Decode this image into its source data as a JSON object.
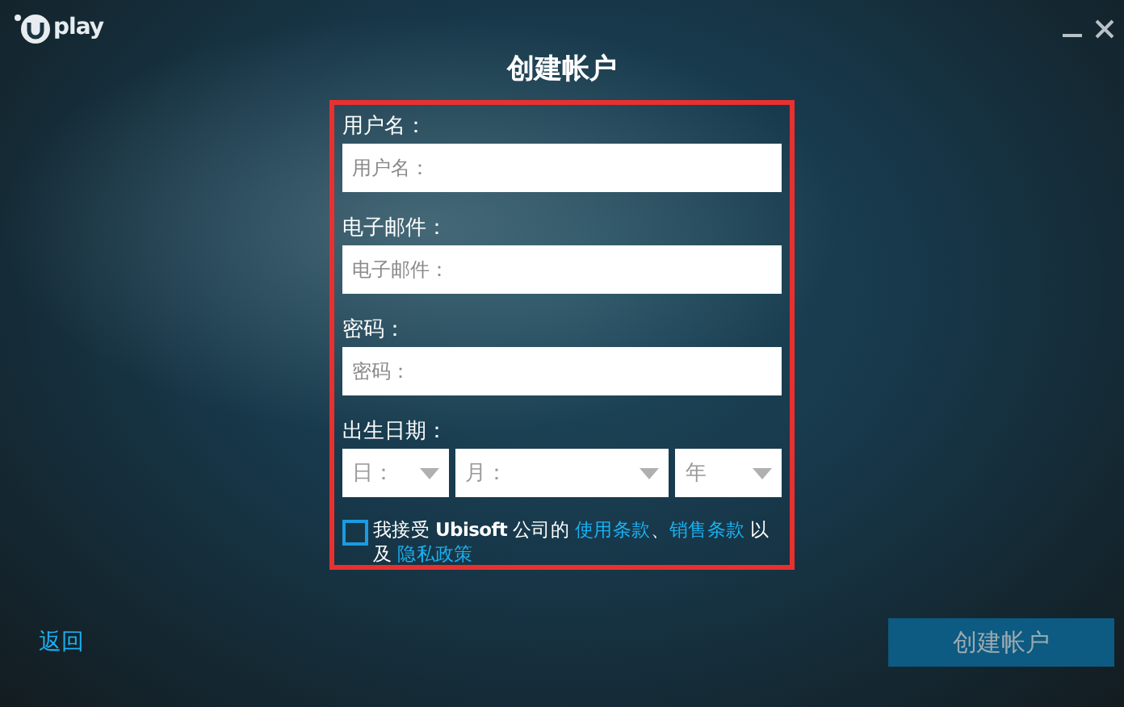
{
  "window": {
    "logo": "play",
    "title": "创建帐户"
  },
  "fields": [
    {
      "label": "用户名：",
      "placeholder": "用户名："
    },
    {
      "label": "电子邮件：",
      "placeholder": "电子邮件："
    },
    {
      "label": "密码：",
      "placeholder": "密码："
    }
  ],
  "birth_date": {
    "label": "出生日期：",
    "selects": [
      {
        "placeholder": "日："
      },
      {
        "placeholder": "月："
      },
      {
        "placeholder": "年"
      }
    ]
  },
  "terms": {
    "checked": false,
    "parts": [
      {
        "kind": "text",
        "text": "我接受 **Ubisoft** 公司的 "
      },
      {
        "kind": "link",
        "text": "使用条款"
      },
      {
        "kind": "text",
        "text": "、"
      },
      {
        "kind": "link",
        "text": "销售条款"
      },
      {
        "kind": "text",
        "text": " 以及 "
      },
      {
        "kind": "link",
        "text": "隐私政策"
      }
    ]
  },
  "back_link": "返回",
  "create_button": {
    "label": "创建帐户",
    "disabled": true
  }
}
